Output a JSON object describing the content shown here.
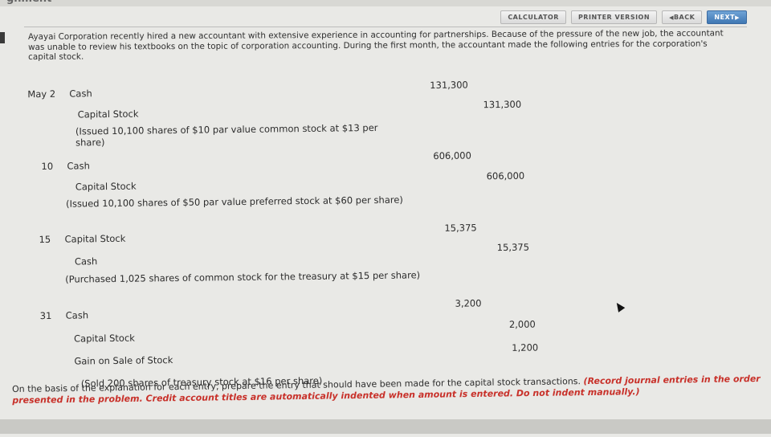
{
  "header": {
    "partial_title": "gnment"
  },
  "toolbar": {
    "calculator": "CALCULATOR",
    "printer_version": "PRINTER VERSION",
    "back": "BACK",
    "next": "NEXT"
  },
  "problem": {
    "intro": "Ayayai Corporation recently hired a new accountant with extensive experience in accounting for partnerships. Because of the pressure of the new job, the accountant was unable to review his textbooks on the topic of corporation accounting. During the first month, the accountant made the following entries for the corporation's capital stock."
  },
  "entries": [
    {
      "date": "May 2",
      "lines": [
        {
          "account": "Cash",
          "debit": "131,300",
          "credit": ""
        },
        {
          "account": "Capital Stock",
          "debit": "",
          "credit": "131,300"
        }
      ],
      "explanation": "(Issued 10,100 shares of $10 par value common stock at $13 per share)"
    },
    {
      "date": "10",
      "lines": [
        {
          "account": "Cash",
          "debit": "606,000",
          "credit": ""
        },
        {
          "account": "Capital Stock",
          "debit": "",
          "credit": "606,000"
        }
      ],
      "explanation": "(Issued 10,100 shares of $50 par value preferred stock at $60 per share)"
    },
    {
      "date": "15",
      "lines": [
        {
          "account": "Capital Stock",
          "debit": "15,375",
          "credit": ""
        },
        {
          "account": "Cash",
          "debit": "",
          "credit": "15,375"
        }
      ],
      "explanation": "(Purchased 1,025 shares of common stock for the treasury at $15 per share)"
    },
    {
      "date": "31",
      "lines": [
        {
          "account": "Cash",
          "debit": "3,200",
          "credit": ""
        },
        {
          "account": "Capital Stock",
          "debit": "",
          "credit": "2,000"
        },
        {
          "account": "Gain on Sale of Stock",
          "debit": "",
          "credit": "1,200"
        }
      ],
      "explanation": "(Sold 200 shares of treasury stock at $16 per share)"
    }
  ],
  "instructions": {
    "text": "On the basis of the explanation for each entry, prepare the entry that should have been made for the capital stock transactions.",
    "note": "(Record journal entries in the order presented in the problem. Credit account titles are automatically indented when amount is entered. Do not indent manually.)"
  },
  "colors": {
    "note_red": "#c8312a",
    "next_blue": "#4a82bd"
  }
}
